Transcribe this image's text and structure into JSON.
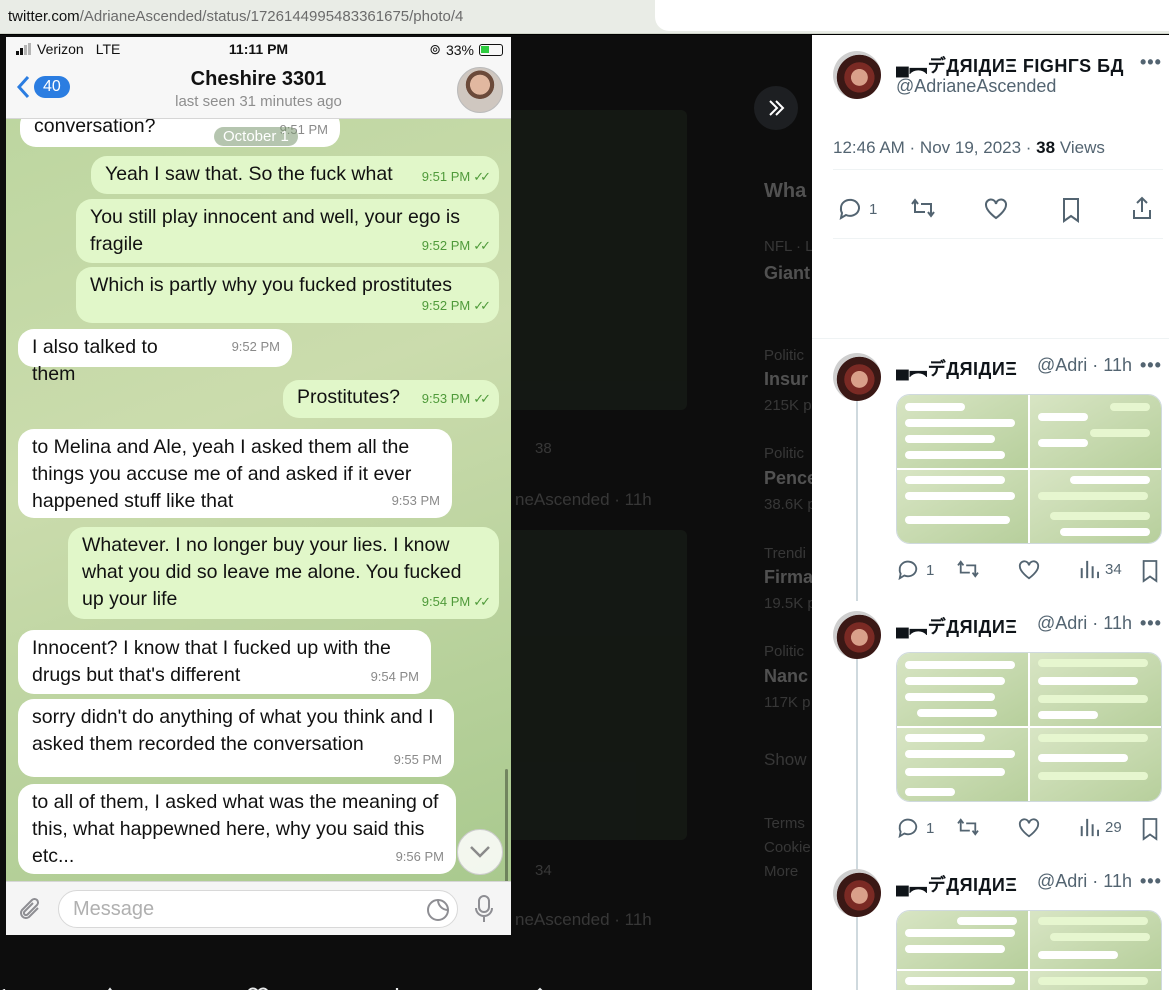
{
  "browser": {
    "url_domain": "twitter.com",
    "url_path": "/AdrianeAscended/status/1726144995483361675/photo/4"
  },
  "phone": {
    "status": {
      "carrier": "Verizon",
      "network": "LTE",
      "time": "11:11 PM",
      "battery": "33%"
    },
    "header": {
      "back_count": "40",
      "contact_name": "Cheshire 3301",
      "last_seen": "last seen 31 minutes ago"
    },
    "date_pill": "October 1",
    "composer_placeholder": "Message",
    "messages": [
      {
        "dir": "in",
        "text": "conversation?",
        "time": "9:51 PM"
      },
      {
        "dir": "out",
        "text": "Yeah I saw that. So the fuck what",
        "time": "9:51 PM"
      },
      {
        "dir": "out",
        "text": "You still play innocent and well, your ego is fragile",
        "time": "9:52 PM"
      },
      {
        "dir": "out",
        "text": "Which is partly why you fucked prostitutes",
        "time": "9:52 PM"
      },
      {
        "dir": "in",
        "text": "I also talked to them",
        "time": "9:52 PM"
      },
      {
        "dir": "out",
        "text": "Prostitutes?",
        "time": "9:53 PM"
      },
      {
        "dir": "in",
        "text": "to Melina and Ale, yeah I asked them all the things you accuse me of and asked if it ever happened stuff like that",
        "time": "9:53 PM"
      },
      {
        "dir": "out",
        "text": "Whatever. I no longer buy your lies. I know what you did so leave me alone. You fucked up your life",
        "time": "9:54 PM"
      },
      {
        "dir": "in",
        "text": "Innocent? I know that I fucked up with the drugs but that's different",
        "time": "9:54 PM"
      },
      {
        "dir": "in",
        "text": "sorry didn't do anything of what you think and I asked them recorded the conversation",
        "time": "9:55 PM"
      },
      {
        "dir": "in",
        "text": "to all of them, I asked what was the meaning of this, what happewned here, why you said this etc...",
        "time": "9:56 PM"
      }
    ]
  },
  "media_actions": {
    "replies": "1",
    "views": "38"
  },
  "background_ghost": {
    "heading": "Wha",
    "nfl": "NFL · L",
    "giant": "Giant",
    "politics1": "Politic",
    "insur": "Insur",
    "insur_count": "215K p",
    "politics2": "Politic",
    "pence": "Pence",
    "pence_count": "38.6K p",
    "trending": "Trendi",
    "firma": "Firma",
    "firma_count": "19.5K p",
    "politics3": "Politic",
    "nanc": "Nanc",
    "nanc_count": "117K p",
    "show": "Show",
    "terms": "Terms",
    "cookie": "Cookie",
    "more": "More",
    "handle_ghost": "neAscended · 11h",
    "n38": "38",
    "n34": "34"
  },
  "panel": {
    "main_post": {
      "display_name": "▄︻デДЯIДИΞ FIGHΓS БД",
      "handle": "@AdrianeAscended",
      "timestamp": "12:46 AM · Nov 19, 2023 · ",
      "views_count": "38",
      "views_label": " Views",
      "reply_count": "1"
    },
    "replies": [
      {
        "display_name": "▄︻デДЯIДИΞ",
        "handle": "@Adri · 11h",
        "reply_count": "1",
        "views": "34"
      },
      {
        "display_name": "▄︻デДЯIДИΞ",
        "handle": "@Adri · 11h",
        "reply_count": "1",
        "views": "29"
      },
      {
        "display_name": "▄︻デДЯIДИΞ",
        "handle": "@Adri · 11h"
      }
    ],
    "more_glyph": "•••"
  },
  "colors": {
    "outgoing_bubble": "#e1f7c9",
    "incoming_bubble": "#ffffff",
    "telegram_blue": "#2b7de1",
    "read_ticks": "#4f9a3a"
  }
}
